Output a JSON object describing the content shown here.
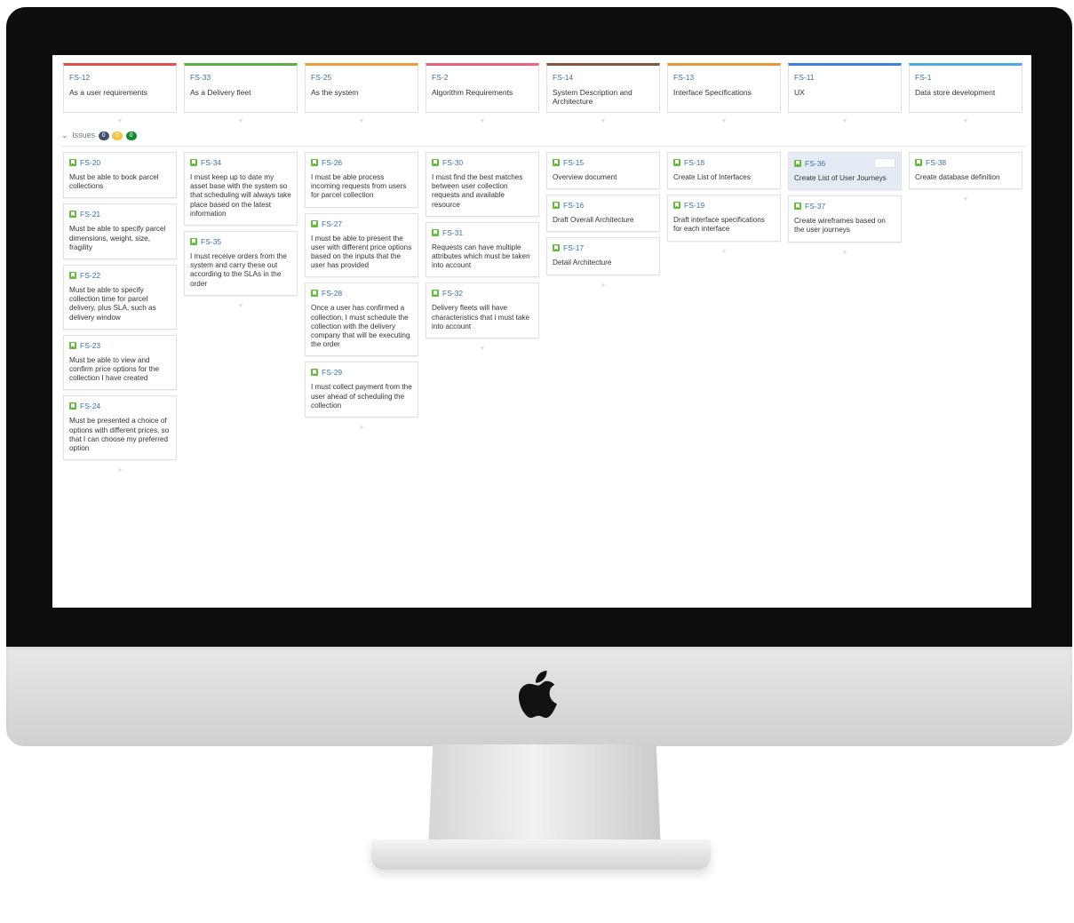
{
  "epics": [
    {
      "key": "FS-12",
      "title": "As a user requirements",
      "color": "#e0504d"
    },
    {
      "key": "FS-33",
      "title": "As a Delivery fleet",
      "color": "#5aad3e"
    },
    {
      "key": "FS-25",
      "title": "As the system",
      "color": "#f09b3b"
    },
    {
      "key": "FS-2",
      "title": "Algorithm Requirements",
      "color": "#e9647c"
    },
    {
      "key": "FS-14",
      "title": "System Description and Architecture",
      "color": "#80573b"
    },
    {
      "key": "FS-13",
      "title": "Interface Specifications",
      "color": "#e9963a"
    },
    {
      "key": "FS-11",
      "title": "UX",
      "color": "#3a83dd"
    },
    {
      "key": "FS-1",
      "title": "Data store development",
      "color": "#4ea9e6"
    }
  ],
  "add_symbol": "+",
  "issues_label": "Issues",
  "issues_chevron": "⌄",
  "status_counts": [
    {
      "value": "0",
      "color": "#42526e"
    },
    {
      "value": "0",
      "color": "#f6c342"
    },
    {
      "value": "0",
      "color": "#14892c"
    }
  ],
  "columns": [
    {
      "cards": [
        {
          "key": "FS-20",
          "summary": "Must be able to book parcel collections"
        },
        {
          "key": "FS-21",
          "summary": "Must be able to specify parcel dimensions, weight, size, fragility"
        },
        {
          "key": "FS-22",
          "summary": "Must be able to specify collection time for parcel delivery, plus SLA, such as delivery window"
        },
        {
          "key": "FS-23",
          "summary": "Must be able to view and confirm price options for the collection I have created"
        },
        {
          "key": "FS-24",
          "summary": "Must be presented a choice of options with different prices, so that I can choose my preferred option"
        }
      ]
    },
    {
      "cards": [
        {
          "key": "FS-34",
          "summary": "I must keep up to date my asset base with the system so that scheduling will always take place based on the latest information"
        },
        {
          "key": "FS-35",
          "summary": "I must receive orders from the system and carry these out according to the SLAs in the order"
        }
      ]
    },
    {
      "cards": [
        {
          "key": "FS-26",
          "summary": "I must be able process incoming requests from users for parcel collection"
        },
        {
          "key": "FS-27",
          "summary": "I must be able to present the user with different price options based on the inputs that the user has provided"
        },
        {
          "key": "FS-28",
          "summary": "Once a user has confirmed a collection, I must schedule the collection with the delivery company that will be executing the order"
        },
        {
          "key": "FS-29",
          "summary": "I must collect payment from the user ahead of scheduling the collection"
        }
      ]
    },
    {
      "cards": [
        {
          "key": "FS-30",
          "summary": "I must find the best matches between user collection requests and available resource"
        },
        {
          "key": "FS-31",
          "summary": "Requests can have multiple attributes which must be taken into account"
        },
        {
          "key": "FS-32",
          "summary": "Delivery fleets will have characteristics that i must take into account"
        }
      ]
    },
    {
      "cards": [
        {
          "key": "FS-15",
          "summary": "Overview document"
        },
        {
          "key": "FS-16",
          "summary": "Draft Overall Architecture"
        },
        {
          "key": "FS-17",
          "summary": "Detail Architecture"
        }
      ]
    },
    {
      "cards": [
        {
          "key": "FS-18",
          "summary": "Create List of Interfaces"
        },
        {
          "key": "FS-19",
          "summary": "Draft interface specifications for each interface"
        }
      ]
    },
    {
      "cards": [
        {
          "key": "FS-36",
          "summary": "Create List of User Journeys",
          "selected": true
        },
        {
          "key": "FS-37",
          "summary": "Create wireframes based on the user journeys"
        }
      ]
    },
    {
      "cards": [
        {
          "key": "FS-38",
          "summary": "Create database definition"
        }
      ]
    }
  ]
}
